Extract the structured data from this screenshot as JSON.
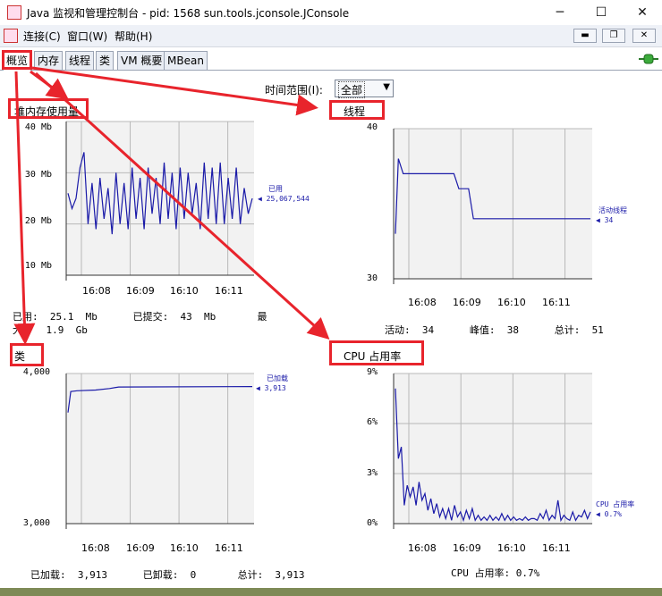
{
  "window": {
    "title": "Java 监视和管理控制台 - pid: 1568 sun.tools.jconsole.JConsole"
  },
  "menu": {
    "connect": "连接(C)",
    "window": "窗口(W)",
    "help": "帮助(H)"
  },
  "tabs": [
    "概览",
    "内存",
    "线程",
    "类",
    "VM 概要",
    "MBean"
  ],
  "time_range": {
    "label": "时间范围(I):",
    "value": "全部"
  },
  "panels": {
    "heap": {
      "title": "堆内存使用量",
      "y_ticks": [
        "40 Mb",
        "30 Mb",
        "20 Mb",
        "10 Mb"
      ],
      "x_ticks": [
        "16:08",
        "16:09",
        "16:10",
        "16:11"
      ],
      "legend_name": "已用",
      "legend_value": "25,067,544",
      "stats_line1": "已用:  25.1  Mb      已提交:  43  Mb       最",
      "stats_line2": "大:   1.9  Gb"
    },
    "threads": {
      "title": "线程",
      "y_ticks": [
        "40",
        "30"
      ],
      "x_ticks": [
        "16:08",
        "16:09",
        "16:10",
        "16:11"
      ],
      "legend_name": "活动线程",
      "legend_value": "34",
      "stats": "活动:  34      峰值:  38      总计:  51"
    },
    "classes": {
      "title": "类",
      "y_ticks": [
        "4,000",
        "3,000"
      ],
      "x_ticks": [
        "16:08",
        "16:09",
        "16:10",
        "16:11"
      ],
      "legend_name": "已加载",
      "legend_value": "3,913",
      "stats": "已加载:  3,913      已卸载:  0       总计:  3,913"
    },
    "cpu": {
      "title": "CPU 占用率",
      "y_ticks": [
        "9%",
        "6%",
        "3%",
        "0%"
      ],
      "x_ticks": [
        "16:08",
        "16:09",
        "16:10",
        "16:11"
      ],
      "legend_name": "CPU 占用率",
      "legend_value": "0.7%",
      "stats": "CPU 占用率: 0.7%"
    }
  },
  "chart_data": [
    {
      "type": "line",
      "title": "堆内存使用量",
      "ylabel": "",
      "ylim": [
        10,
        40
      ],
      "unit": "Mb",
      "series": [
        {
          "name": "已用",
          "values": [
            26,
            23,
            25,
            31,
            34,
            20,
            28,
            19,
            29,
            21,
            27,
            18,
            30,
            20,
            28,
            19,
            31,
            21,
            29,
            19,
            31,
            22,
            29,
            20,
            32,
            21,
            30,
            19,
            31,
            21,
            30,
            22,
            28,
            19,
            32,
            21,
            31,
            20,
            32,
            20,
            29,
            21,
            31,
            20,
            27,
            22,
            25
          ]
        }
      ]
    },
    {
      "type": "line",
      "title": "线程",
      "ylabel": "",
      "ylim": [
        30,
        40
      ],
      "series": [
        {
          "name": "活动线程",
          "values": [
            [
              0,
              33
            ],
            [
              0.3,
              38
            ],
            [
              0.8,
              37
            ],
            [
              6,
              37
            ],
            [
              6.5,
              36
            ],
            [
              7.5,
              36
            ],
            [
              8,
              34
            ],
            [
              20,
              34
            ]
          ]
        }
      ]
    },
    {
      "type": "line",
      "title": "类",
      "ylabel": "",
      "ylim": [
        3000,
        4000
      ],
      "series": [
        {
          "name": "已加载",
          "values": [
            [
              0,
              3740
            ],
            [
              0.3,
              3880
            ],
            [
              1,
              3885
            ],
            [
              3,
              3890
            ],
            [
              4.5,
              3900
            ],
            [
              5.5,
              3910
            ],
            [
              20,
              3913
            ]
          ]
        }
      ]
    },
    {
      "type": "line",
      "title": "CPU 占用率",
      "ylabel": "",
      "ylim": [
        0,
        9
      ],
      "unit": "%",
      "series": [
        {
          "name": "CPU 占用率",
          "values": [
            8.1,
            3.9,
            4.6,
            1.1,
            2.3,
            1.6,
            2.2,
            1.1,
            2.5,
            1.4,
            1.8,
            0.8,
            1.5,
            0.6,
            1.2,
            0.4,
            0.9,
            0.3,
            0.9,
            0.2,
            1.1,
            0.4,
            0.7,
            0.2,
            0.8,
            0.3,
            0.9,
            0.2,
            0.5,
            0.2,
            0.4,
            0.2,
            0.5,
            0.2,
            0.4,
            0.2,
            0.6,
            0.2,
            0.5,
            0.2,
            0.4,
            0.2,
            0.3,
            0.2,
            0.4,
            0.2,
            0.3,
            0.3,
            0.2,
            0.6,
            0.3,
            0.8,
            0.2,
            0.5,
            0.3,
            1.4,
            0.2,
            0.5,
            0.3,
            0.2,
            0.7,
            0.2,
            0.5,
            0.4,
            0.8,
            0.3,
            0.7
          ]
        }
      ]
    }
  ],
  "colors": {
    "series": "#1a1aa8",
    "highlight": "#e8242c",
    "grid": "#b8b8b8",
    "plot_bg": "#f2f2f2"
  },
  "icons": {
    "app": "java-cup-icon",
    "connection": "plug-connected-icon"
  }
}
